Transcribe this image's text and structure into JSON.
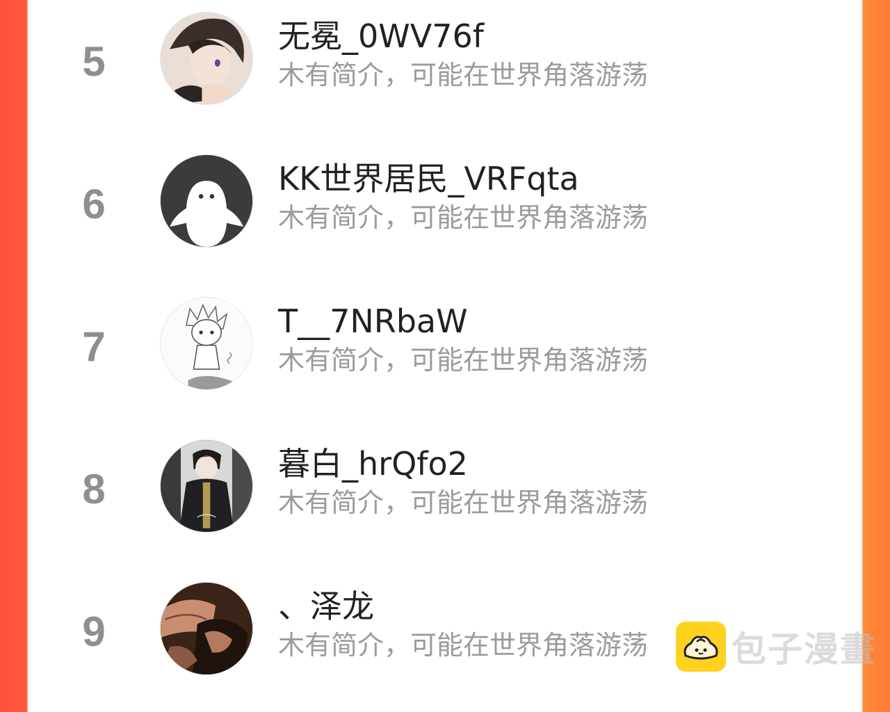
{
  "ranking": {
    "items": [
      {
        "rank": "5",
        "name": "无冕_0WV76f",
        "intro": "木有简介，可能在世界角落游荡",
        "avatar": "anime-boy-avatar"
      },
      {
        "rank": "6",
        "name": "KK世界居民_VRFqta",
        "intro": "木有简介，可能在世界角落游荡",
        "avatar": "default-ghost-avatar"
      },
      {
        "rank": "7",
        "name": "T__7NRbaW",
        "intro": "木有简介，可能在世界角落游荡",
        "avatar": "sketch-character-avatar"
      },
      {
        "rank": "8",
        "name": "暮白_hrQfo2",
        "intro": "木有简介，可能在世界角落游荡",
        "avatar": "uniform-character-avatar"
      },
      {
        "rank": "9",
        "name": "、泽龙",
        "intro": "木有简介，可能在世界角落游荡",
        "avatar": "dark-character-avatar"
      }
    ]
  },
  "watermark": {
    "text": "包子漫畫",
    "icon": "bun-logo-icon"
  },
  "colors": {
    "left_edge": "#ff4d3f",
    "right_edge": "#ff7b34",
    "rank": "#8f8f8f",
    "intro": "#9b9b9b",
    "logo": "#ffd21f"
  }
}
